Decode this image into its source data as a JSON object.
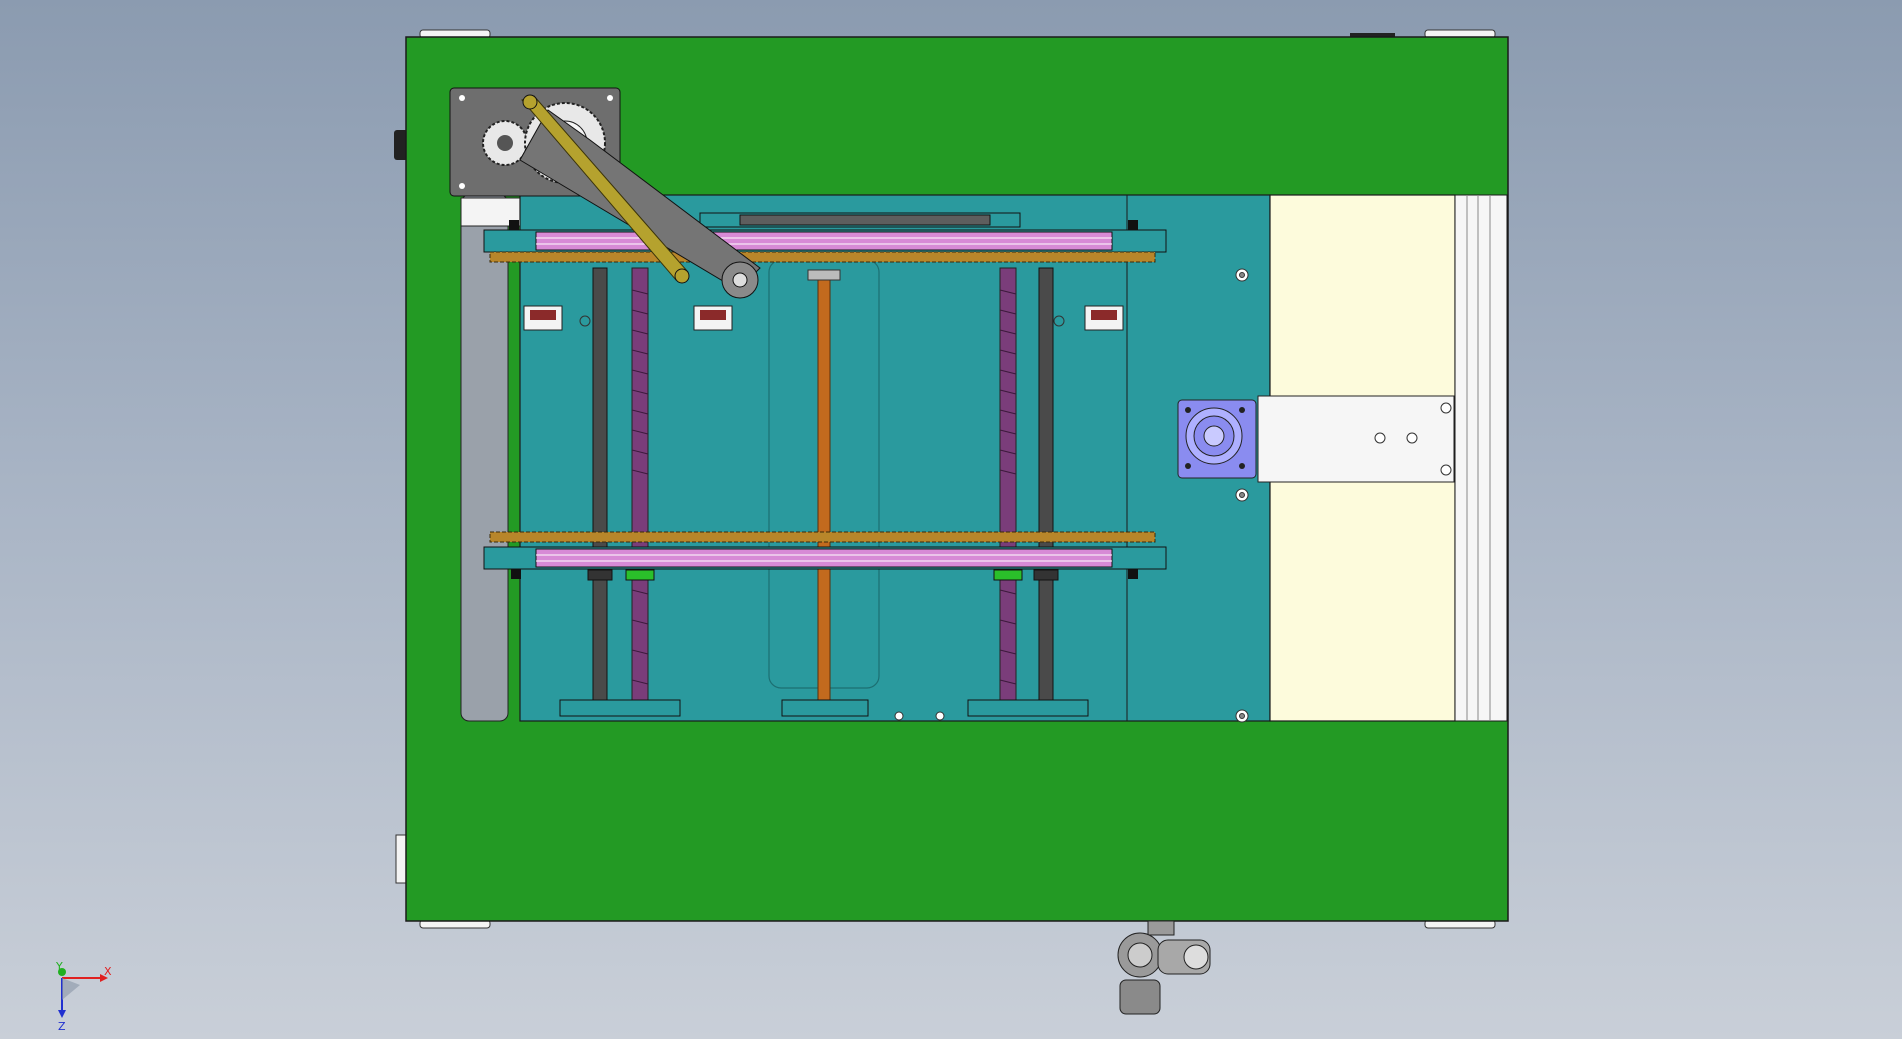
{
  "triad": {
    "x_label": "X",
    "y_label": "Y",
    "z_label": "Z"
  },
  "colors": {
    "frame_green": "#239a24",
    "teal_plate": "#2a9a9e",
    "cream_panel": "#fdfbdc",
    "pink_rail": "#d78ad6",
    "chain_orange": "#b8862a",
    "rod_dark": "#4a4a4a",
    "screw_purple": "#7a3d7a",
    "lead_screw_orange": "#c26a1e",
    "motor_blue": "#8a8cf0",
    "gear_grey": "#6e6e6e",
    "background_top": "#8b9bb0",
    "background_bottom": "#c9cfd8"
  }
}
